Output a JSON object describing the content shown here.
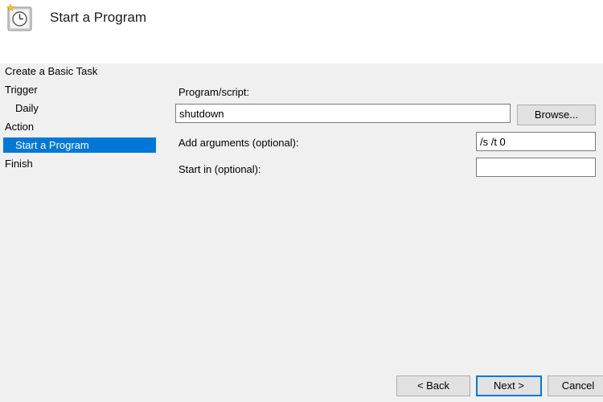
{
  "header": {
    "title": "Start a Program",
    "icon": "task-scheduler-clock-icon"
  },
  "nav": {
    "items": [
      {
        "label": "Create a Basic Task",
        "selected": false
      },
      {
        "label": "Trigger",
        "selected": false
      },
      {
        "label": "Daily",
        "selected": false
      },
      {
        "label": "Action",
        "selected": false
      },
      {
        "label": "Start a Program",
        "selected": true
      },
      {
        "label": "Finish",
        "selected": false
      }
    ]
  },
  "form": {
    "program_label": "Program/script:",
    "program_value": "shutdown",
    "browse_label": "Browse...",
    "args_label": "Add arguments (optional):",
    "args_value": "/s /t 0",
    "startin_label": "Start in (optional):",
    "startin_value": ""
  },
  "buttons": {
    "back": "< Back",
    "next": "Next >",
    "cancel": "Cancel"
  },
  "colors": {
    "selection": "#0078d7",
    "header_bg": "#ffffff",
    "body_bg": "#f0f0f0"
  }
}
